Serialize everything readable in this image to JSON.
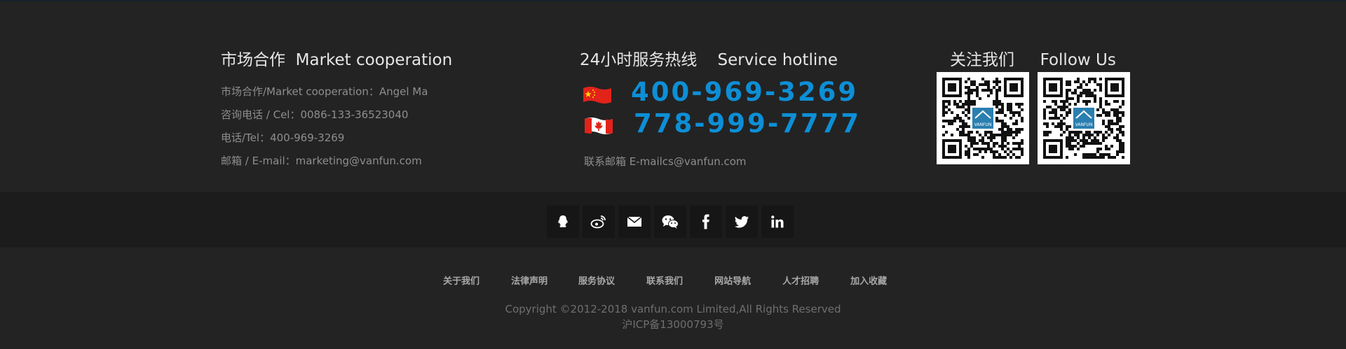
{
  "market": {
    "title_cn": "市场合作",
    "title_en": "Market cooperation",
    "lines": [
      "市场合作/Market cooperation：Angel Ma",
      "咨询电话 / Cel：0086-133-36523040",
      "电话/Tel：400-969-3269",
      "邮箱 / E-mail：marketing@vanfun.com"
    ]
  },
  "hotline": {
    "title_cn": "24小时服务热线",
    "title_en": "Service hotline",
    "phone_china": "400-969-3269",
    "phone_canada": "778-999-7777",
    "email": "联系邮箱 E-mailcs@vanfun.com"
  },
  "follow": {
    "title_cn": "关注我们",
    "title_en": "Follow Us",
    "qr_logo_text": "VANFUN"
  },
  "social": [
    "qq-icon",
    "weibo-icon",
    "mail-icon",
    "wechat-icon",
    "facebook-icon",
    "twitter-icon",
    "linkedin-icon"
  ],
  "nav": [
    "关于我们",
    "法律声明",
    "服务协议",
    "联系我们",
    "网站导航",
    "人才招聘",
    "加入收藏"
  ],
  "copyright": "Copyright ©2012-2018 vanfun.com Limited,All Rights Reserved",
  "icp": "沪ICP备13000793号",
  "colors": {
    "accent": "#0d8fd6",
    "background": "#232323",
    "band": "#1c1c1c"
  }
}
